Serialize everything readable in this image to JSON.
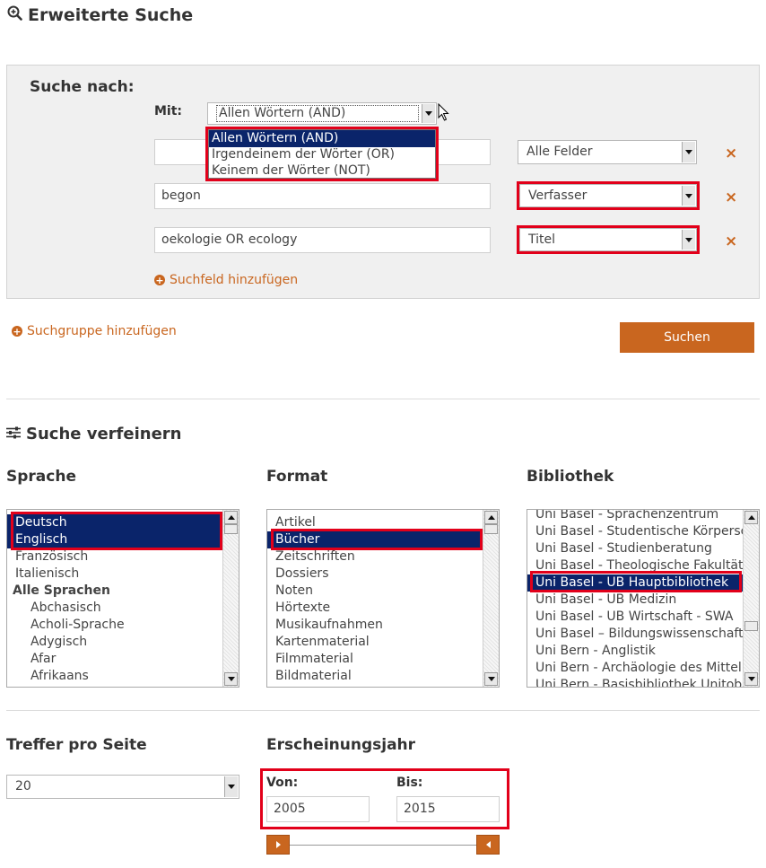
{
  "header": {
    "title": "Erweiterte Suche",
    "icon": "zoom-in-icon"
  },
  "search_group": {
    "title": "Suche nach:",
    "match_label": "Mit:",
    "match_value": "Allen Wörtern (AND)",
    "match_options": [
      "Allen Wörtern (AND)",
      "Irgendeinem der Wörter (OR)",
      "Keinem der Wörter (NOT)"
    ],
    "rows": [
      {
        "value": "",
        "field": "Alle Felder"
      },
      {
        "value": "begon",
        "field": "Verfasser"
      },
      {
        "value": "oekologie OR ecology",
        "field": "Titel"
      }
    ],
    "add_field_label": "Suchfeld hinzufügen",
    "remove_icon": "×"
  },
  "add_group_label": "Suchgruppe hinzufügen",
  "search_button": "Suchen",
  "refine": {
    "title": "Suche verfeinern",
    "language": {
      "title": "Sprache",
      "options": [
        {
          "label": "Deutsch",
          "selected": true
        },
        {
          "label": "Englisch",
          "selected": true
        },
        {
          "label": "Französisch"
        },
        {
          "label": "Italienisch"
        },
        {
          "label": "Alle Sprachen",
          "group": true
        },
        {
          "label": "Abchasisch",
          "indent": true
        },
        {
          "label": "Acholi-Sprache",
          "indent": true
        },
        {
          "label": "Adygisch",
          "indent": true
        },
        {
          "label": "Afar",
          "indent": true
        },
        {
          "label": "Afrikaans",
          "indent": true
        }
      ]
    },
    "format": {
      "title": "Format",
      "options": [
        {
          "label": "Artikel"
        },
        {
          "label": "Bücher",
          "selected": true
        },
        {
          "label": "Zeitschriften"
        },
        {
          "label": "Dossiers"
        },
        {
          "label": "Noten"
        },
        {
          "label": "Hörtexte"
        },
        {
          "label": "Musikaufnahmen"
        },
        {
          "label": "Kartenmaterial"
        },
        {
          "label": "Filmmaterial"
        },
        {
          "label": "Bildmaterial"
        }
      ]
    },
    "library": {
      "title": "Bibliothek",
      "options": [
        {
          "label": "Uni Basel - Sprachenzentrum"
        },
        {
          "label": "Uni Basel - Studentische Körperschaft"
        },
        {
          "label": "Uni Basel - Studienberatung"
        },
        {
          "label": "Uni Basel - Theologische Fakultät"
        },
        {
          "label": "Uni Basel - UB Hauptbibliothek",
          "selected": true
        },
        {
          "label": "Uni Basel - UB Medizin"
        },
        {
          "label": "Uni Basel - UB Wirtschaft - SWA"
        },
        {
          "label": "Uni Basel – Bildungswissenschaften"
        },
        {
          "label": "Uni Bern - Anglistik"
        },
        {
          "label": "Uni Bern - Archäologie des Mittelmeerraums"
        },
        {
          "label": "Uni Bern - Basisbibliothek Unitobler"
        }
      ]
    }
  },
  "results_per_page": {
    "title": "Treffer pro Seite",
    "value": "20"
  },
  "year": {
    "title": "Erscheinungsjahr",
    "from_label": "Von:",
    "from_value": "2005",
    "to_label": "Bis:",
    "to_value": "2015"
  },
  "colors": {
    "accent": "#c9661f",
    "highlight": "#e2001a",
    "selection": "#0a246a"
  }
}
